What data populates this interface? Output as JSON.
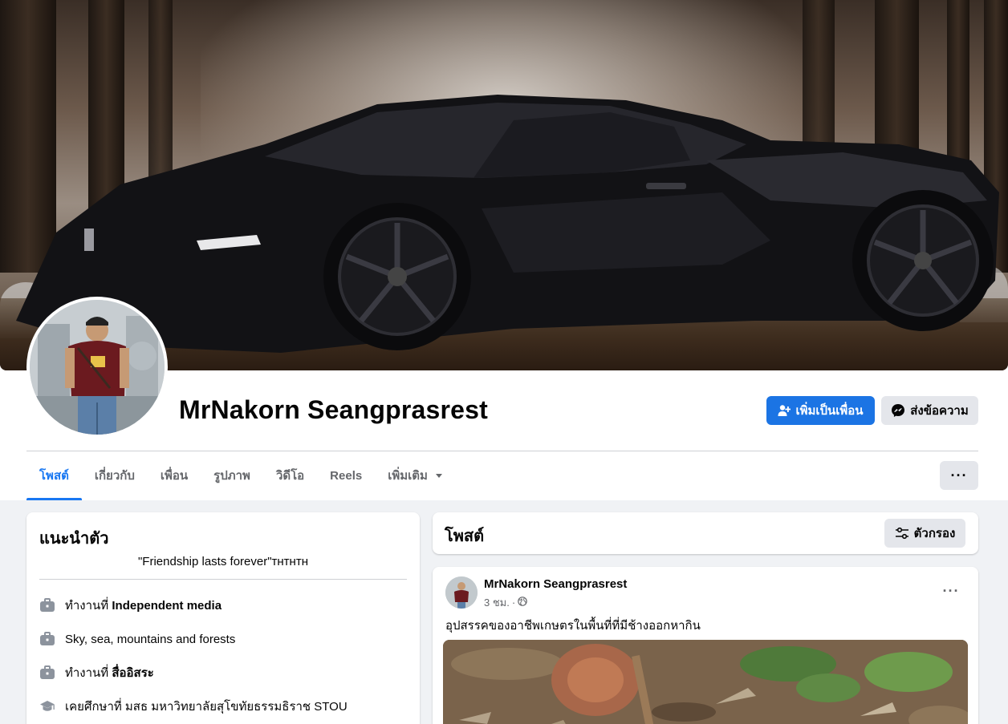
{
  "profile": {
    "name": "MrNakorn Seangprasrest",
    "add_friend_label": "เพิ่มเป็นเพื่อน",
    "message_label": "ส่งข้อความ"
  },
  "tabs": [
    {
      "label": "โพสต์",
      "active": true
    },
    {
      "label": "เกี่ยวกับ"
    },
    {
      "label": "เพื่อน"
    },
    {
      "label": "รูปภาพ"
    },
    {
      "label": "วิดีโอ"
    },
    {
      "label": "Reels"
    },
    {
      "label": "เพิ่มเติม"
    }
  ],
  "more_button": "···",
  "intro": {
    "title": "แนะนำตัว",
    "bio": "\"Friendship lasts forever\"ᴛʜᴛʜᴛʜ",
    "items": [
      {
        "icon": "briefcase-icon",
        "prefix": "ทำงานที่ ",
        "bold": "Independent media"
      },
      {
        "icon": "briefcase-icon",
        "prefix": "Sky, sea, mountains and forests",
        "bold": ""
      },
      {
        "icon": "briefcase-icon",
        "prefix": "ทำงานที่ ",
        "bold": "สื่ออิสระ"
      },
      {
        "icon": "graduation-cap-icon",
        "prefix": "เคยศึกษาที่ มสธ มหาวิทยาลัยสุโขทัยธรรมธิราช STOU",
        "bold": ""
      }
    ]
  },
  "posts_header": {
    "title": "โพสต์",
    "filter_label": "ตัวกรอง"
  },
  "post": {
    "author": "MrNakorn Seangprasrest",
    "time": "3 ชม.",
    "separator": "·",
    "privacy_icon": "globe-icon",
    "more": "···",
    "text": "อุปสรรคของอาชีพเกษตรในพื้นที่ที่มีช้างออกหากิน"
  },
  "colors": {
    "primary": "#1b74e4",
    "active_tab": "#1877f2",
    "secondary_button": "#e4e6eb",
    "page_bg": "#f0f2f5"
  }
}
